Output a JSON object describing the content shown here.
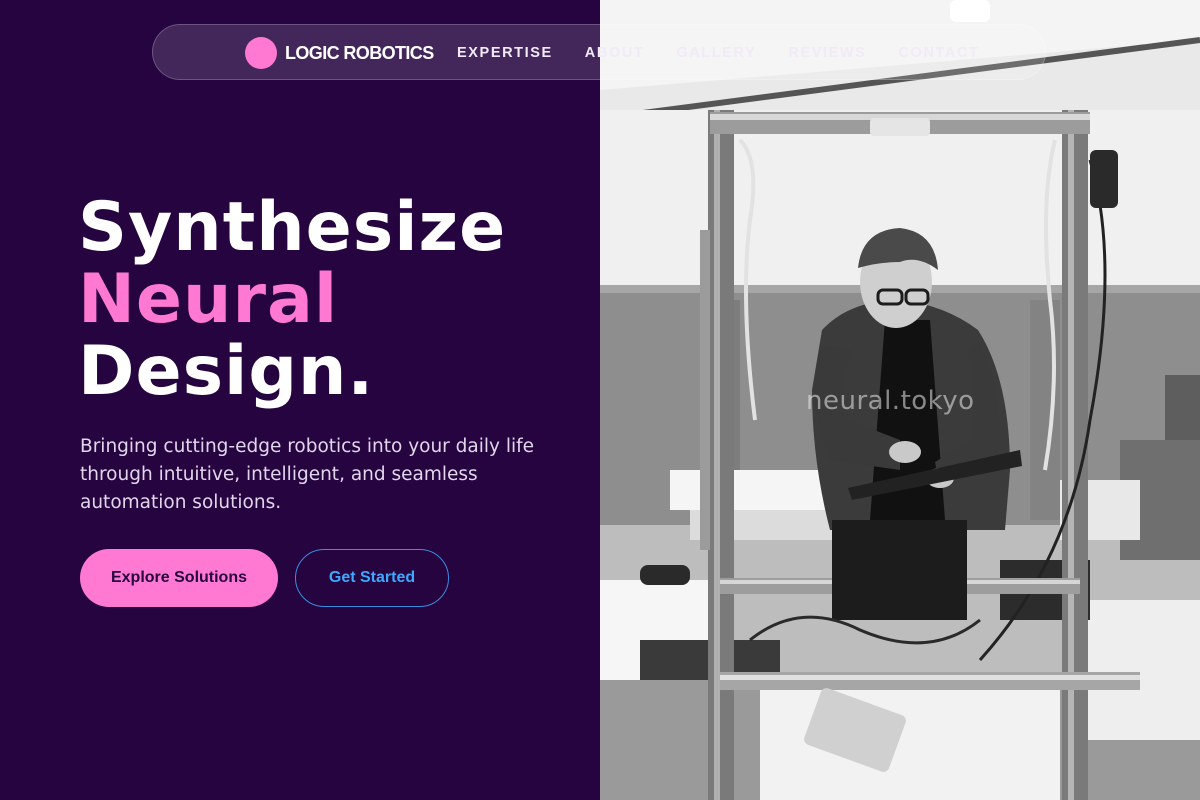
{
  "brand": {
    "name": "LOGIC ROBOTICS",
    "logo_icon": "pink-circle-logo"
  },
  "nav": {
    "links": [
      {
        "label": "EXPERTISE"
      },
      {
        "label": "ABOUT"
      },
      {
        "label": "GALLERY"
      },
      {
        "label": "REVIEWS"
      },
      {
        "label": "CONTACT"
      }
    ]
  },
  "hero": {
    "headline": {
      "line1": "Synthesize",
      "line2": "Neural",
      "line3": "Design."
    },
    "subcopy": "Bringing cutting-edge robotics into your daily life through intuitive, intelligent, and seamless automation solutions.",
    "primary_button": "Explore Solutions",
    "secondary_button": "Get Started"
  },
  "photo": {
    "description_icon": "workshop-photo",
    "watermark": "neural.tokyo"
  },
  "colors": {
    "background": "#250440",
    "accent": "#ff78d2",
    "link_blue": "#3ea8ff",
    "text": "#ffffff"
  }
}
